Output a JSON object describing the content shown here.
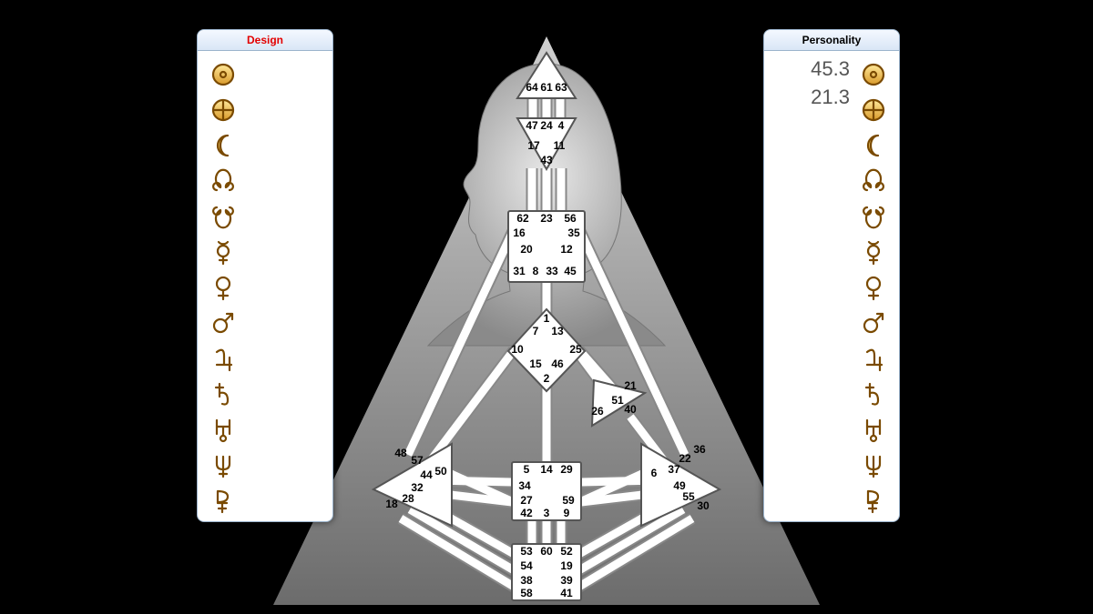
{
  "panel_left": {
    "title": "Design"
  },
  "panel_right": {
    "title": "Personality"
  },
  "personality_values": [
    "45.3",
    "21.3"
  ],
  "design_values": [],
  "planets": [
    "sun",
    "earth",
    "moon",
    "north-node",
    "south-node",
    "mercury",
    "venus",
    "mars",
    "jupiter",
    "saturn",
    "uranus",
    "neptune",
    "pluto"
  ],
  "centers": {
    "head": {
      "gates": [
        "64",
        "61",
        "63"
      ]
    },
    "ajna": {
      "gates": [
        "47",
        "24",
        "4",
        "17",
        "11",
        "43"
      ]
    },
    "throat": {
      "gates": [
        "62",
        "23",
        "56",
        "16",
        "35",
        "20",
        "12",
        "31",
        "8",
        "33",
        "45"
      ]
    },
    "g": {
      "gates": [
        "1",
        "7",
        "13",
        "10",
        "25",
        "15",
        "46",
        "2"
      ]
    },
    "heart": {
      "gates": [
        "21",
        "51",
        "26",
        "40"
      ]
    },
    "sacral": {
      "gates": [
        "5",
        "14",
        "29",
        "34",
        "27",
        "59",
        "42",
        "3",
        "9"
      ]
    },
    "spleen": {
      "gates": [
        "48",
        "57",
        "44",
        "50",
        "32",
        "28",
        "18"
      ]
    },
    "solar": {
      "gates": [
        "36",
        "22",
        "37",
        "6",
        "49",
        "55",
        "30"
      ]
    },
    "root": {
      "gates": [
        "53",
        "60",
        "52",
        "54",
        "19",
        "38",
        "39",
        "58",
        "41"
      ]
    }
  }
}
